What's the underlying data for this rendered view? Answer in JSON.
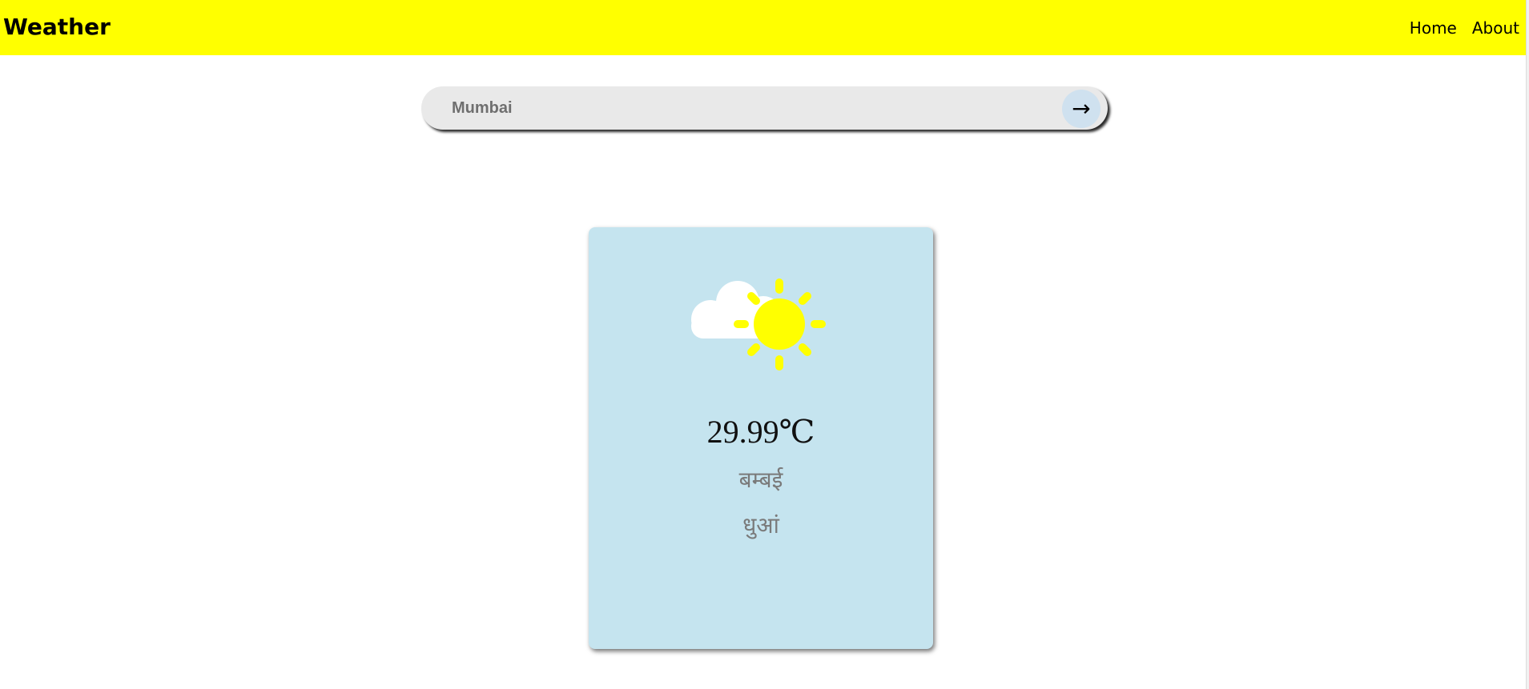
{
  "header": {
    "brand": "Weather",
    "nav": [
      {
        "label": "Home"
      },
      {
        "label": "About"
      }
    ]
  },
  "search": {
    "value": "Mumbai",
    "placeholder": "Mumbai",
    "button_icon": "→",
    "button_icon_name": "arrow-right-icon"
  },
  "weather": {
    "temperature": "29.99℃",
    "city": "बम्बई",
    "condition": "धुआं",
    "icon_name": "partly-sunny-icon"
  },
  "colors": {
    "header_bg": "#ffff00",
    "card_bg": "#c5e4ef",
    "sun": "#ffff00",
    "cloud": "#ffffff",
    "search_bg": "#e9e9e9",
    "search_button_bg": "#cfe1ef"
  }
}
